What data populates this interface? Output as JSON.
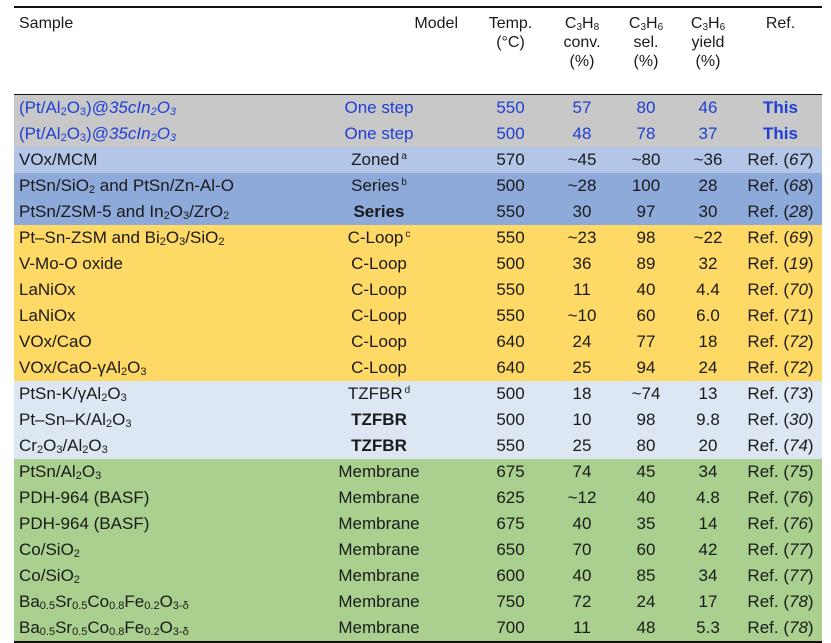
{
  "header": {
    "sample": "Sample",
    "model": "Model",
    "temp": [
      "Temp.",
      "(°C)"
    ],
    "conv": [
      "C3H8",
      "conv.",
      "(%)"
    ],
    "sel": [
      "C3H6",
      "sel.",
      "(%)"
    ],
    "yield": [
      "C3H6",
      "yield",
      "(%)"
    ],
    "ref": "Ref."
  },
  "rows": [
    {
      "sample": "(Pt/Al2O3)@35cIn2O3",
      "model": "One step",
      "note": "",
      "temp": "550",
      "conv": "57",
      "sel": "80",
      "yield": "46",
      "ref": "This",
      "bg": "#c8c8c8",
      "text": "#1f3fd6",
      "bold": false
    },
    {
      "sample": "(Pt/Al2O3)@35cIn2O3",
      "model": "One step",
      "note": "",
      "temp": "500",
      "conv": "48",
      "sel": "78",
      "yield": "37",
      "ref": "This",
      "bg": "#c8c8c8",
      "text": "#1f3fd6",
      "bold": false
    },
    {
      "sample": "VOx/MCM",
      "model": "Zoned",
      "note": "a",
      "temp": "570",
      "conv": "~45",
      "sel": "~80",
      "yield": "~36",
      "ref": "Ref. (67)",
      "bg": "#b4c6e7",
      "text": "#1a1a1a",
      "bold": false
    },
    {
      "sample": "PtSn/SiO2 and PtSn/Zn-Al-O",
      "model": "Series",
      "note": "b",
      "temp": "500",
      "conv": "~28",
      "sel": "100",
      "yield": "28",
      "ref": "Ref. (68)",
      "bg": "#8eaadb",
      "text": "#1a1a1a",
      "bold": false
    },
    {
      "sample": "PtSn/ZSM-5 and In2O3/ZrO2",
      "model": "Series",
      "note": "",
      "temp": "550",
      "conv": "30",
      "sel": "97",
      "yield": "30",
      "ref": "Ref. (28)",
      "bg": "#8eaadb",
      "text": "#1a1a1a",
      "bold": true
    },
    {
      "sample": "Pt–Sn-ZSM and Bi2O3/SiO2",
      "model": "C-Loop",
      "note": "c",
      "temp": "550",
      "conv": "~23",
      "sel": "98",
      "yield": "~22",
      "ref": "Ref. (69)",
      "bg": "#ffd966",
      "text": "#1a1a1a",
      "bold": false
    },
    {
      "sample": "V-Mo-O oxide",
      "model": "C-Loop",
      "note": "",
      "temp": "500",
      "conv": "36",
      "sel": "89",
      "yield": "32",
      "ref": "Ref. (19)",
      "bg": "#ffd966",
      "text": "#1a1a1a",
      "bold": false
    },
    {
      "sample": "LaNiOx",
      "model": "C-Loop",
      "note": "",
      "temp": "550",
      "conv": "11",
      "sel": "40",
      "yield": "4.4",
      "ref": "Ref. (70)",
      "bg": "#ffd966",
      "text": "#1a1a1a",
      "bold": false
    },
    {
      "sample": "LaNiOx",
      "model": "C-Loop",
      "note": "",
      "temp": "550",
      "conv": "~10",
      "sel": "60",
      "yield": "6.0",
      "ref": "Ref. (71)",
      "bg": "#ffd966",
      "text": "#1a1a1a",
      "bold": false
    },
    {
      "sample": "VOx/CaO",
      "model": "C-Loop",
      "note": "",
      "temp": "640",
      "conv": "24",
      "sel": "77",
      "yield": "18",
      "ref": "Ref. (72)",
      "bg": "#ffd966",
      "text": "#1a1a1a",
      "bold": false
    },
    {
      "sample": "VOx/CaO-γAl2O3",
      "model": "C-Loop",
      "note": "",
      "temp": "640",
      "conv": "25",
      "sel": "94",
      "yield": "24",
      "ref": "Ref. (72)",
      "bg": "#ffd966",
      "text": "#1a1a1a",
      "bold": false
    },
    {
      "sample": "PtSn-K/γAl2O3",
      "model": "TZFBR",
      "note": "d",
      "temp": "500",
      "conv": "18",
      "sel": "~74",
      "yield": "13",
      "ref": "Ref. (73)",
      "bg": "#dde7f3",
      "text": "#1a1a1a",
      "bold": false
    },
    {
      "sample": "Pt–Sn–K/Al2O3",
      "model": "TZFBR",
      "note": "",
      "temp": "500",
      "conv": "10",
      "sel": "98",
      "yield": "9.8",
      "ref": "Ref. (30)",
      "bg": "#dde7f3",
      "text": "#1a1a1a",
      "bold": true
    },
    {
      "sample": "Cr2O3/Al2O3",
      "model": "TZFBR",
      "note": "",
      "temp": "550",
      "conv": "25",
      "sel": "80",
      "yield": "20",
      "ref": "Ref. (74)",
      "bg": "#dde7f3",
      "text": "#1a1a1a",
      "bold": true
    },
    {
      "sample": "PtSn/Al2O3",
      "model": "Membrane",
      "note": "",
      "temp": "675",
      "conv": "74",
      "sel": "45",
      "yield": "34",
      "ref": "Ref. (75)",
      "bg": "#a9d08e",
      "text": "#1a1a1a",
      "bold": false
    },
    {
      "sample": "PDH-964 (BASF)",
      "model": "Membrane",
      "note": "",
      "temp": "625",
      "conv": "~12",
      "sel": "40",
      "yield": "4.8",
      "ref": "Ref. (76)",
      "bg": "#a9d08e",
      "text": "#1a1a1a",
      "bold": false
    },
    {
      "sample": "PDH-964 (BASF)",
      "model": "Membrane",
      "note": "",
      "temp": "675",
      "conv": "40",
      "sel": "35",
      "yield": "14",
      "ref": "Ref. (76)",
      "bg": "#a9d08e",
      "text": "#1a1a1a",
      "bold": false
    },
    {
      "sample": "Co/SiO2",
      "model": "Membrane",
      "note": "",
      "temp": "650",
      "conv": "70",
      "sel": "60",
      "yield": "42",
      "ref": "Ref. (77)",
      "bg": "#a9d08e",
      "text": "#1a1a1a",
      "bold": false
    },
    {
      "sample": "Co/SiO2",
      "model": "Membrane",
      "note": "",
      "temp": "600",
      "conv": "40",
      "sel": "85",
      "yield": "34",
      "ref": "Ref. (77)",
      "bg": "#a9d08e",
      "text": "#1a1a1a",
      "bold": false
    },
    {
      "sample": "Ba0.5Sr0.5Co0.8Fe0.2O3-δ",
      "model": "Membrane",
      "note": "",
      "temp": "750",
      "conv": "72",
      "sel": "24",
      "yield": "17",
      "ref": "Ref. (78)",
      "bg": "#a9d08e",
      "text": "#1a1a1a",
      "bold": false
    },
    {
      "sample": "Ba0.5Sr0.5Co0.8Fe0.2O3-δ",
      "model": "Membrane",
      "note": "",
      "temp": "700",
      "conv": "11",
      "sel": "48",
      "yield": "5.3",
      "ref": "Ref. (78)",
      "bg": "#a9d08e",
      "text": "#1a1a1a",
      "bold": false
    }
  ]
}
